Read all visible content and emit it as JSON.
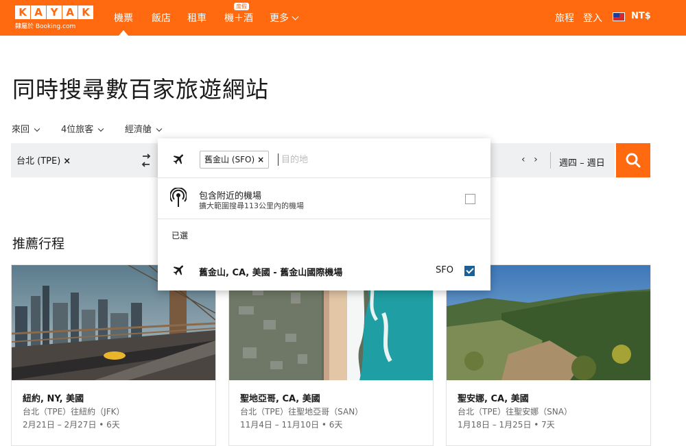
{
  "brand": {
    "logo_letters": [
      "K",
      "A",
      "Y",
      "A",
      "K"
    ],
    "logo_sub": "隸屬於 Booking.com",
    "accent": "#ff690f"
  },
  "nav": {
    "items": [
      {
        "label": "機票",
        "active": true
      },
      {
        "label": "飯店"
      },
      {
        "label": "租車"
      },
      {
        "label": "機＋酒",
        "badge": "度假"
      },
      {
        "label": "更多"
      }
    ],
    "right": {
      "trips": "旅程",
      "login": "登入",
      "currency": "NT$",
      "flag_icon": "taiwan-flag-icon"
    }
  },
  "hero": {
    "title": "同時搜尋數百家旅遊網站"
  },
  "options": {
    "trip_type": "來回",
    "travelers": "4位旅客",
    "cabin": "經濟艙"
  },
  "search": {
    "origin": "台北 (TPE)",
    "dates": "週四 – 週日",
    "prev": "‹",
    "next": "›",
    "button_icon": "search-icon"
  },
  "dropdown": {
    "chip": "舊金山 (SFO)",
    "placeholder": "目的地",
    "nearby": {
      "title": "包含附近的機場",
      "subtitle": "擴大範圍搜尋113公里內的機場",
      "checked": false
    },
    "selected_label": "已選",
    "selected": {
      "name": "舊金山, CA, 美國 - 舊金山國際機場",
      "code": "SFO",
      "checked": true
    }
  },
  "recommended": {
    "title": "推薦行程",
    "cards": [
      {
        "name": "紐約, NY, 美國",
        "route": "台北（TPE）往紐約（JFK）",
        "dates": "2月21日 – 2月27日 • 6天"
      },
      {
        "name": "聖地亞哥, CA, 美國",
        "route": "台北（TPE）往聖地亞哥（SAN）",
        "dates": "11月4日 – 11月10日 • 6天"
      },
      {
        "name": "聖安娜, CA, 美國",
        "route": "台北（TPE）往聖安娜（SNA）",
        "dates": "1月18日 – 1月25日 • 7天"
      }
    ]
  }
}
